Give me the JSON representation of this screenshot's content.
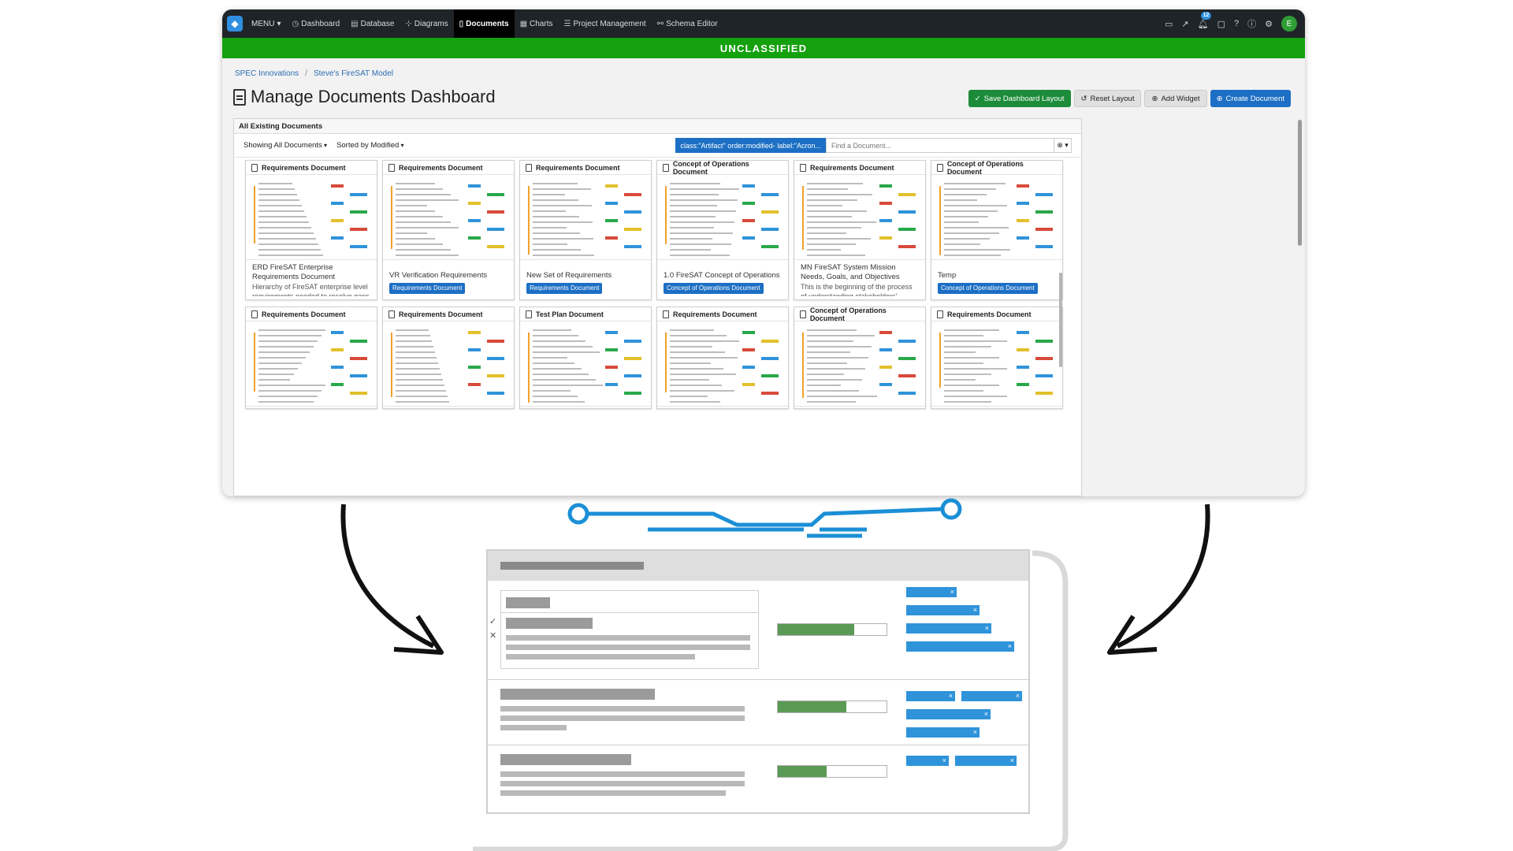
{
  "topbar": {
    "menu_label": "MENU",
    "nav": [
      {
        "label": "Dashboard",
        "icon": "dashboard-icon",
        "active": false
      },
      {
        "label": "Database",
        "icon": "database-icon",
        "active": false
      },
      {
        "label": "Diagrams",
        "icon": "diagrams-icon",
        "active": false
      },
      {
        "label": "Documents",
        "icon": "document-icon",
        "active": true
      },
      {
        "label": "Charts",
        "icon": "charts-icon",
        "active": false
      },
      {
        "label": "Project Management",
        "icon": "list-icon",
        "active": false
      },
      {
        "label": "Schema Editor",
        "icon": "schema-icon",
        "active": false
      }
    ],
    "notification_count": "12",
    "avatar_initial": "E"
  },
  "classification_banner": "UNCLASSIFIED",
  "breadcrumb": [
    "SPEC Innovations",
    "Steve's FireSAT Model"
  ],
  "page_title": "Manage Documents Dashboard",
  "toolbar": {
    "save_label": "Save Dashboard Layout",
    "reset_label": "Reset Layout",
    "add_widget_label": "Add Widget",
    "create_label": "Create Document"
  },
  "widget": {
    "title": "All Existing Documents",
    "showing_label": "Showing All Documents",
    "sorted_label": "Sorted by Modified",
    "filter_chip": "class:\"Artifact\" order:modified- label:\"Acron...",
    "search_placeholder": "Find a Document..."
  },
  "cards": [
    {
      "type": "Requirements Document",
      "title": "ERD FireSAT Enterprise Requirements Document",
      "desc": "Hierarchy of FireSAT enterprise level requirements needed to resolve gaps",
      "tag": ""
    },
    {
      "type": "Requirements Document",
      "title": "VR Verification Requirements",
      "desc": "",
      "tag": "Requirements Document"
    },
    {
      "type": "Requirements Document",
      "title": "New Set of Requirements",
      "desc": "",
      "tag": "Requirements Document"
    },
    {
      "type": "Concept of Operations Document",
      "title": "1.0 FireSAT Concept of Operations",
      "desc": "",
      "tag": "Concept of Operations Document"
    },
    {
      "type": "Requirements Document",
      "title": "MN FireSAT System Mission Needs, Goals, and Objectives",
      "desc": "This is the beginning of the process of understanding stakeholders'",
      "tag": ""
    },
    {
      "type": "Concept of Operations Document",
      "title": "Temp",
      "desc": "",
      "tag": "Concept of Operations Document"
    },
    {
      "type": "Requirements Document",
      "title": "",
      "desc": "",
      "tag": ""
    },
    {
      "type": "Requirements Document",
      "title": "",
      "desc": "",
      "tag": ""
    },
    {
      "type": "Test Plan Document",
      "title": "",
      "desc": "",
      "tag": ""
    },
    {
      "type": "Requirements Document",
      "title": "",
      "desc": "",
      "tag": ""
    },
    {
      "type": "Concept of Operations Document",
      "title": "",
      "desc": "",
      "tag": ""
    },
    {
      "type": "Requirements Document",
      "title": "",
      "desc": "",
      "tag": ""
    }
  ],
  "colors": {
    "banner_green": "#15a10f",
    "primary_blue": "#1c6fc4",
    "topbar_dark": "#1f2429",
    "accent_orange": "#f1a12c",
    "connector_blue": "#1b8fd6"
  }
}
